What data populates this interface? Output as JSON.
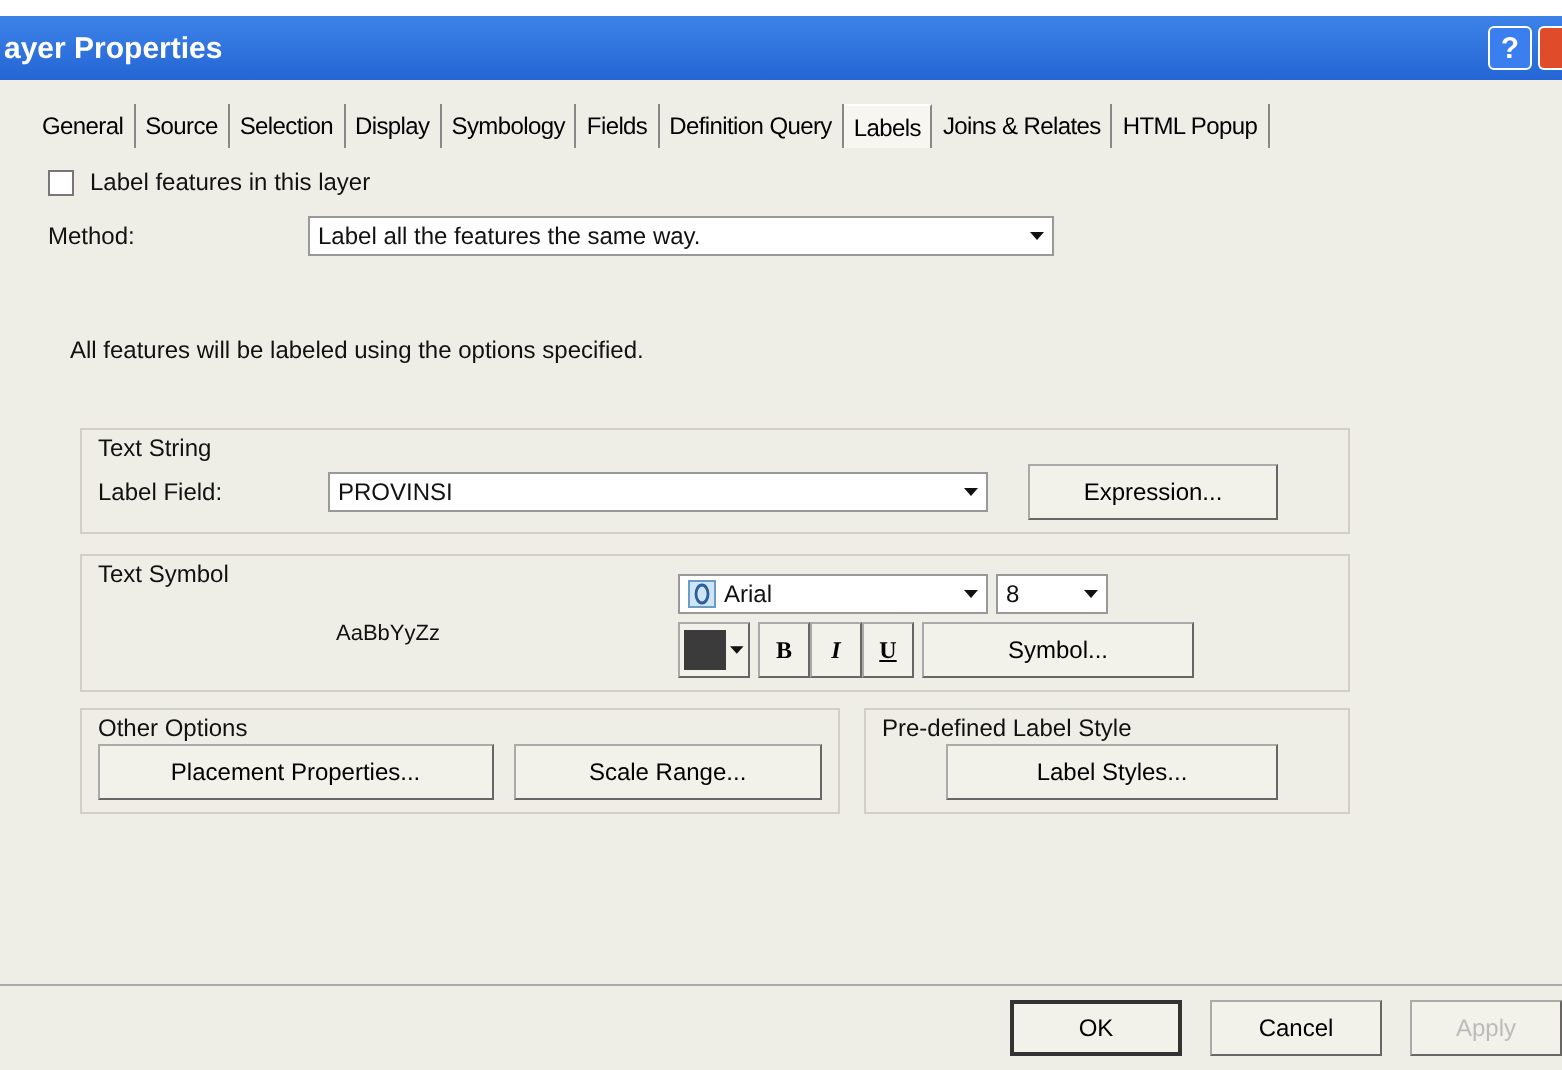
{
  "window": {
    "title": "ayer Properties",
    "help": "?"
  },
  "tabs": [
    {
      "label": "General",
      "selected": false
    },
    {
      "label": "Source",
      "selected": false
    },
    {
      "label": "Selection",
      "selected": false
    },
    {
      "label": "Display",
      "selected": false
    },
    {
      "label": "Symbology",
      "selected": false
    },
    {
      "label": "Fields",
      "selected": false
    },
    {
      "label": "Definition Query",
      "selected": false
    },
    {
      "label": "Labels",
      "selected": true
    },
    {
      "label": "Joins & Relates",
      "selected": false
    },
    {
      "label": "HTML Popup",
      "selected": false
    }
  ],
  "label_features": {
    "label": "Label features in this layer",
    "checked": false
  },
  "method": {
    "label": "Method:",
    "value": "Label all the features the same way."
  },
  "info": "All features will be labeled using the options specified.",
  "text_string": {
    "title": "Text String",
    "field_label": "Label Field:",
    "field_value": "PROVINSI",
    "button": "Expression..."
  },
  "text_symbol": {
    "title": "Text Symbol",
    "preview": "AaBbYyZz",
    "font": "Arial",
    "size": "8",
    "bold": "B",
    "italic": "I",
    "underline": "U",
    "button": "Symbol..."
  },
  "other_options": {
    "title": "Other Options",
    "buttons": [
      "Placement Properties...",
      "Scale Range..."
    ]
  },
  "predefined": {
    "title": "Pre-defined Label Style",
    "button": "Label Styles..."
  },
  "buttons": [
    {
      "label": "OK",
      "disabled": false
    },
    {
      "label": "Cancel",
      "disabled": false
    },
    {
      "label": "Apply",
      "disabled": true
    }
  ]
}
